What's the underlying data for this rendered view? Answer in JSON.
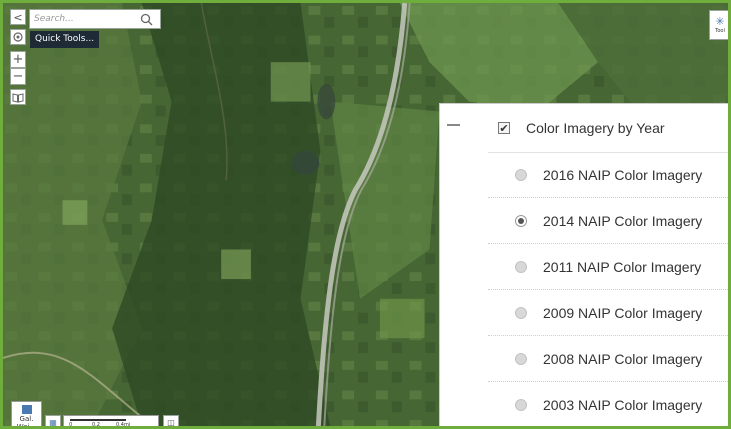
{
  "search": {
    "placeholder": "Search..."
  },
  "quick_tools": {
    "label": "Quick Tools..."
  },
  "toolbar": {
    "collapse_glyph": "<",
    "zoom_in_glyph": "+",
    "zoom_out_glyph": "−"
  },
  "top_right": {
    "label": "Tool"
  },
  "layers": {
    "collapse_glyph": "—",
    "group": {
      "label": "Color Imagery by Year",
      "checked": true
    },
    "items": [
      {
        "label": "2016 NAIP Color Imagery",
        "selected": false
      },
      {
        "label": "2014 NAIP Color Imagery",
        "selected": true
      },
      {
        "label": "2011 NAIP Color Imagery",
        "selected": false
      },
      {
        "label": "2009 NAIP Color Imagery",
        "selected": false
      },
      {
        "label": "2008 NAIP Color Imagery",
        "selected": false
      },
      {
        "label": "2003 NAIP Color Imagery",
        "selected": false
      }
    ]
  },
  "basemap": {
    "label": "Gal. Wei..."
  },
  "scale": {
    "ticks": [
      "0",
      "0.2",
      "0.4mi"
    ]
  },
  "colors": {
    "frame": "#6fae3c",
    "quick_tools_bg": "#1e2a36"
  }
}
